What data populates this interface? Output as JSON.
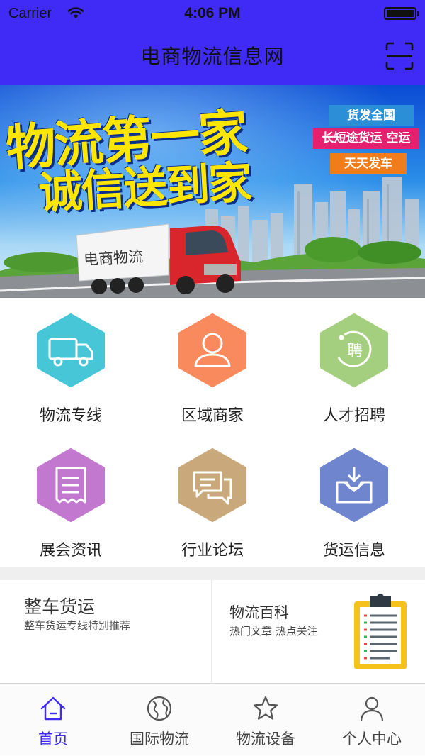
{
  "status_bar": {
    "carrier": "Carrier",
    "time": "4:06 PM"
  },
  "nav": {
    "title": "电商物流信息网",
    "scan_icon": "scan-icon"
  },
  "banner": {
    "headline_1": "物流第一家",
    "headline_2": "诚信送到家",
    "badge_1": "货发全国",
    "badge_2": "长短途货运 空运",
    "badge_3": "天天发车",
    "truck_text": "电商物流"
  },
  "grid": {
    "items": [
      {
        "label": "物流专线",
        "icon": "truck-icon",
        "color": "#46c6d6"
      },
      {
        "label": "区域商家",
        "icon": "user-icon",
        "color": "#f98a5e"
      },
      {
        "label": "人才招聘",
        "icon": "recruit-icon",
        "color": "#a3cf7e"
      },
      {
        "label": "展会资讯",
        "icon": "document-icon",
        "color": "#c278cf"
      },
      {
        "label": "行业论坛",
        "icon": "chat-icon",
        "color": "#c9a87c"
      },
      {
        "label": "货运信息",
        "icon": "box-icon",
        "color": "#6f86cf"
      }
    ]
  },
  "promos": [
    {
      "title": "整车货运",
      "subtitle": "整车货运专线特别推荐"
    },
    {
      "title": "物流百科",
      "subtitle": "热门文章 热点关注",
      "icon": "clipboard-icon"
    }
  ],
  "tabbar": {
    "tabs": [
      {
        "label": "首页",
        "icon": "home-icon",
        "active": true
      },
      {
        "label": "国际物流",
        "icon": "globe-icon",
        "active": false
      },
      {
        "label": "物流设备",
        "icon": "star-icon",
        "active": false
      },
      {
        "label": "个人中心",
        "icon": "person-icon",
        "active": false
      }
    ],
    "active_color": "#3f2bf5"
  },
  "colors": {
    "header_bg": "#3f2bf5",
    "headline": "#ffe600"
  }
}
